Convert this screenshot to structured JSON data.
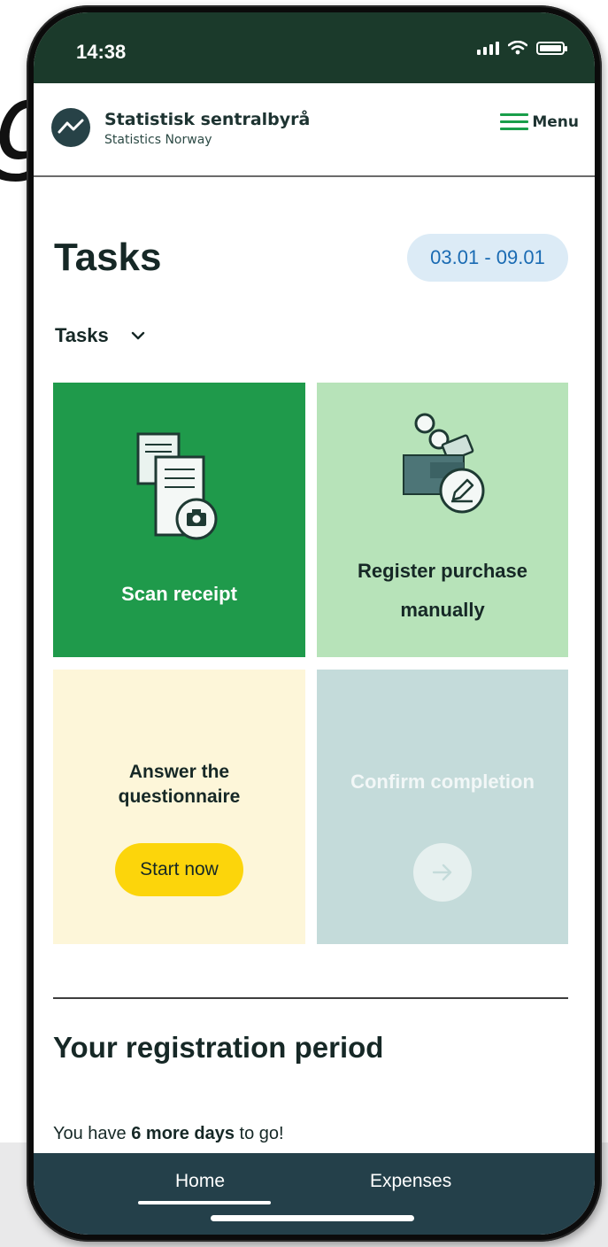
{
  "status_bar": {
    "time": "14:38",
    "icons": [
      "signal-icon",
      "wifi-icon",
      "battery-icon"
    ]
  },
  "header": {
    "brand_name": "Statistisk sentralbyrå",
    "brand_subtitle": "Statistics Norway",
    "menu_label": "Menu"
  },
  "page": {
    "title": "Tasks",
    "date_range": "03.01 - 09.01",
    "filter_label": "Tasks"
  },
  "tiles": {
    "scan_receipt": "Scan receipt",
    "register_line1": "Register purchase",
    "register_line2": "manually",
    "questionnaire_line1": "Answer the",
    "questionnaire_line2": "questionnaire",
    "start_now": "Start now",
    "confirm_completion": "Confirm completion"
  },
  "registration": {
    "title": "Your registration period",
    "text_prefix": "You have ",
    "text_bold": "6 more days",
    "text_suffix": " to go!"
  },
  "bottom_nav": {
    "home": "Home",
    "expenses": "Expenses",
    "active": "Home"
  },
  "colors": {
    "status_bar": "#1b3a2b",
    "accent_green": "#1f9a4b",
    "light_green": "#b7e3b9",
    "cream": "#fdf6d9",
    "disabled_teal": "#c4dbda",
    "yellow_button": "#fcd50b",
    "nav_background": "#24404a",
    "date_pill": "#dcebf6"
  }
}
